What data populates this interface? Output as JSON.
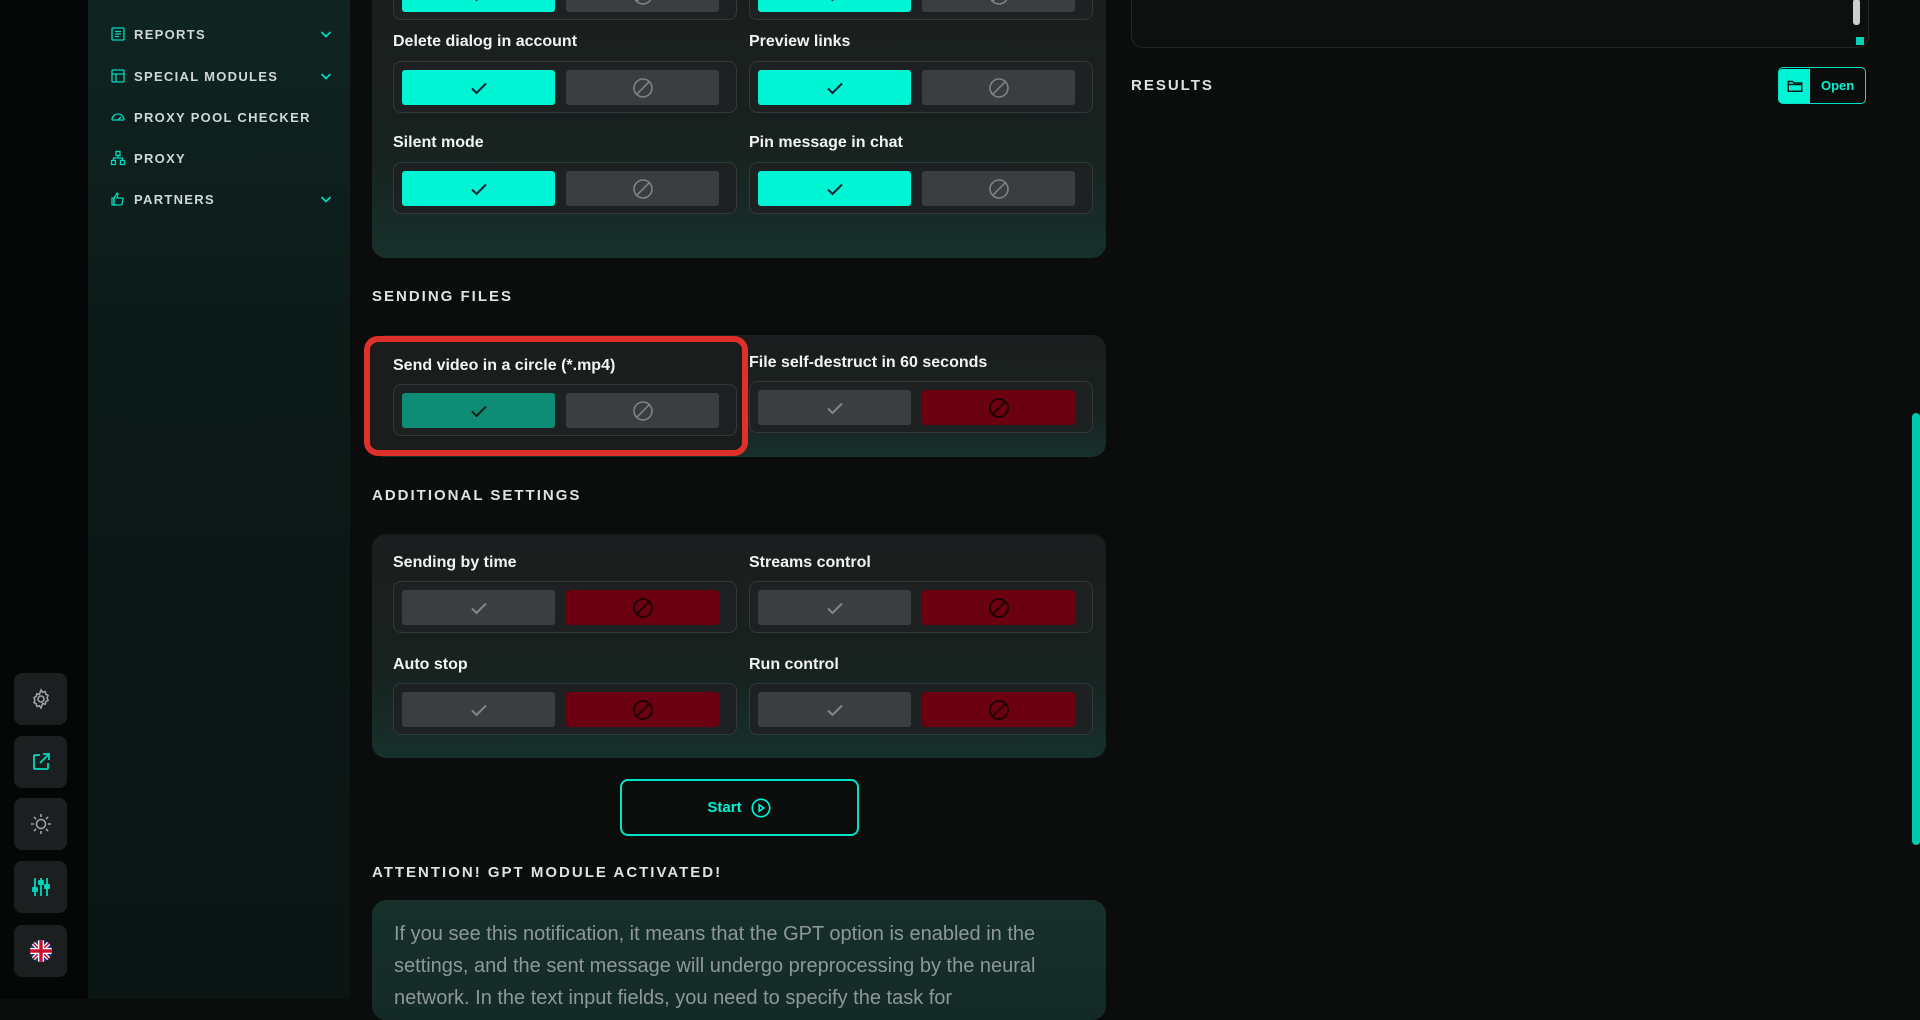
{
  "sidebar": {
    "items": [
      {
        "label": "REPORTS",
        "icon": "report-icon",
        "expandable": true
      },
      {
        "label": "SPECIAL MODULES",
        "icon": "modules-icon",
        "expandable": true
      },
      {
        "label": "PROXY POOL CHECKER",
        "icon": "gauge-icon",
        "expandable": false
      },
      {
        "label": "PROXY",
        "icon": "network-icon",
        "expandable": false
      },
      {
        "label": "PARTNERS",
        "icon": "partners-icon",
        "expandable": true
      }
    ]
  },
  "rail": {
    "buttons": [
      "settings-icon",
      "external-link-icon",
      "theme-icon",
      "sliders-icon",
      "language-flag-icon"
    ]
  },
  "top_card": {
    "options": [
      {
        "label": "Delete dialog in account",
        "state": "yes"
      },
      {
        "label": "Preview links",
        "state": "yes"
      },
      {
        "label": "Silent mode",
        "state": "yes"
      },
      {
        "label": "Pin message in chat",
        "state": "yes"
      }
    ]
  },
  "sending_files": {
    "title": "SENDING FILES",
    "options": [
      {
        "label": "Send video in a circle (*.mp4)",
        "state": "yes",
        "highlighted": true
      },
      {
        "label": "File self-destruct in 60 seconds",
        "state": "no"
      }
    ]
  },
  "additional_settings": {
    "title": "ADDITIONAL SETTINGS",
    "options": [
      {
        "label": "Sending by time",
        "state": "no"
      },
      {
        "label": "Streams control",
        "state": "no"
      },
      {
        "label": "Auto stop",
        "state": "no"
      },
      {
        "label": "Run control",
        "state": "no"
      }
    ]
  },
  "start_button": {
    "label": "Start"
  },
  "gpt_notice": {
    "title": "ATTENTION! GPT MODULE ACTIVATED!",
    "text": "If you see this notification, it means that the GPT option is enabled in the settings, and the sent message will undergo preprocessing by the neural network. In the text input fields, you need to specify the task for"
  },
  "results": {
    "title": "RESULTS",
    "open_button": "Open"
  },
  "colors": {
    "accent": "#00f5d4",
    "accent_dim": "#0f8c75",
    "off": "#3a3e40",
    "danger": "#6b0010",
    "highlight": "#e0302a"
  }
}
